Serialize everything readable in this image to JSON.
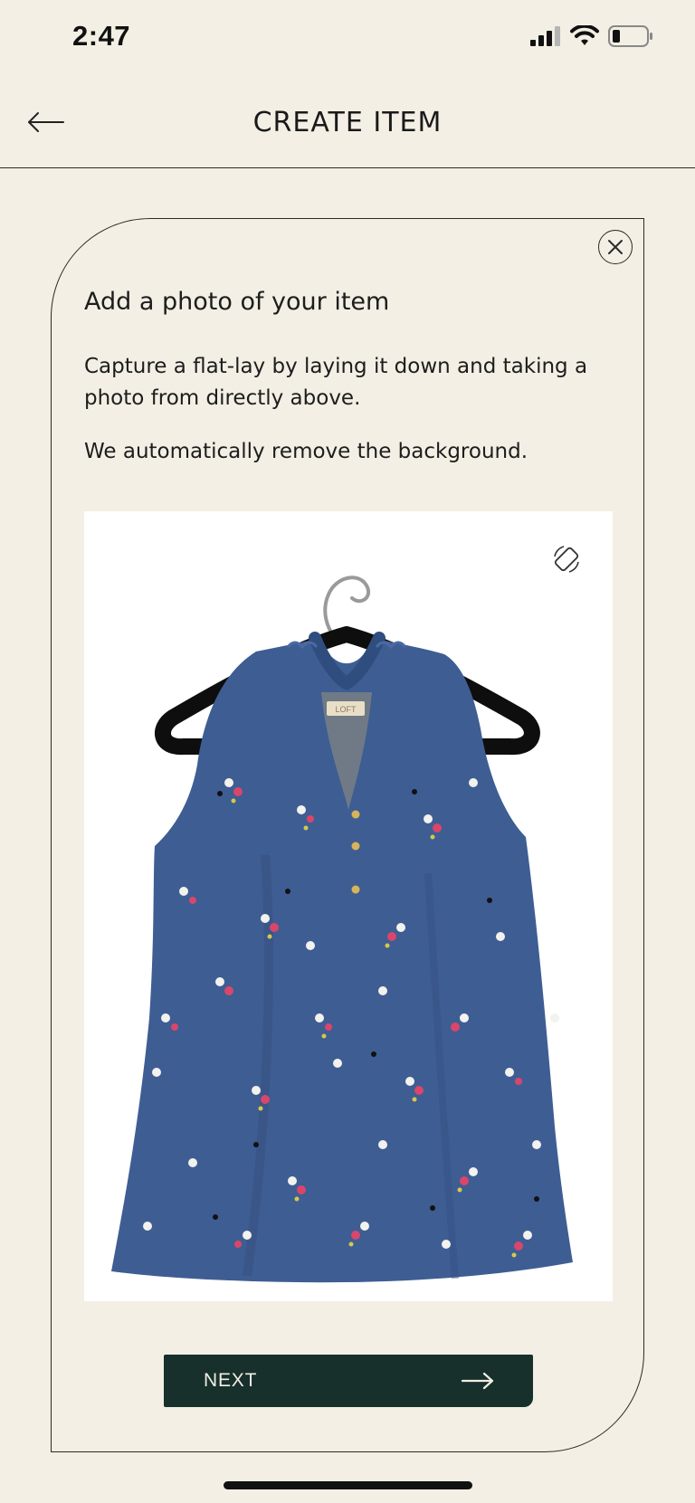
{
  "status_bar": {
    "time": "2:47"
  },
  "header": {
    "title": "CREATE ITEM"
  },
  "card": {
    "heading": "Add a photo of your item",
    "description": "Capture a flat-lay by laying it down and taking a photo from directly above.",
    "note": "We automatically remove the background."
  },
  "photo": {
    "label_tag": "LOFT"
  },
  "next_button": {
    "label": "NEXT"
  },
  "icons": {
    "back": "arrow-left-icon",
    "close": "close-icon",
    "rotate": "rotate-device-icon",
    "next": "arrow-right-icon",
    "signal": "signal-icon",
    "wifi": "wifi-icon",
    "battery": "battery-icon"
  },
  "colors": {
    "background": "#f3efe4",
    "button": "#17302b",
    "shirt": "#3e5d93"
  }
}
